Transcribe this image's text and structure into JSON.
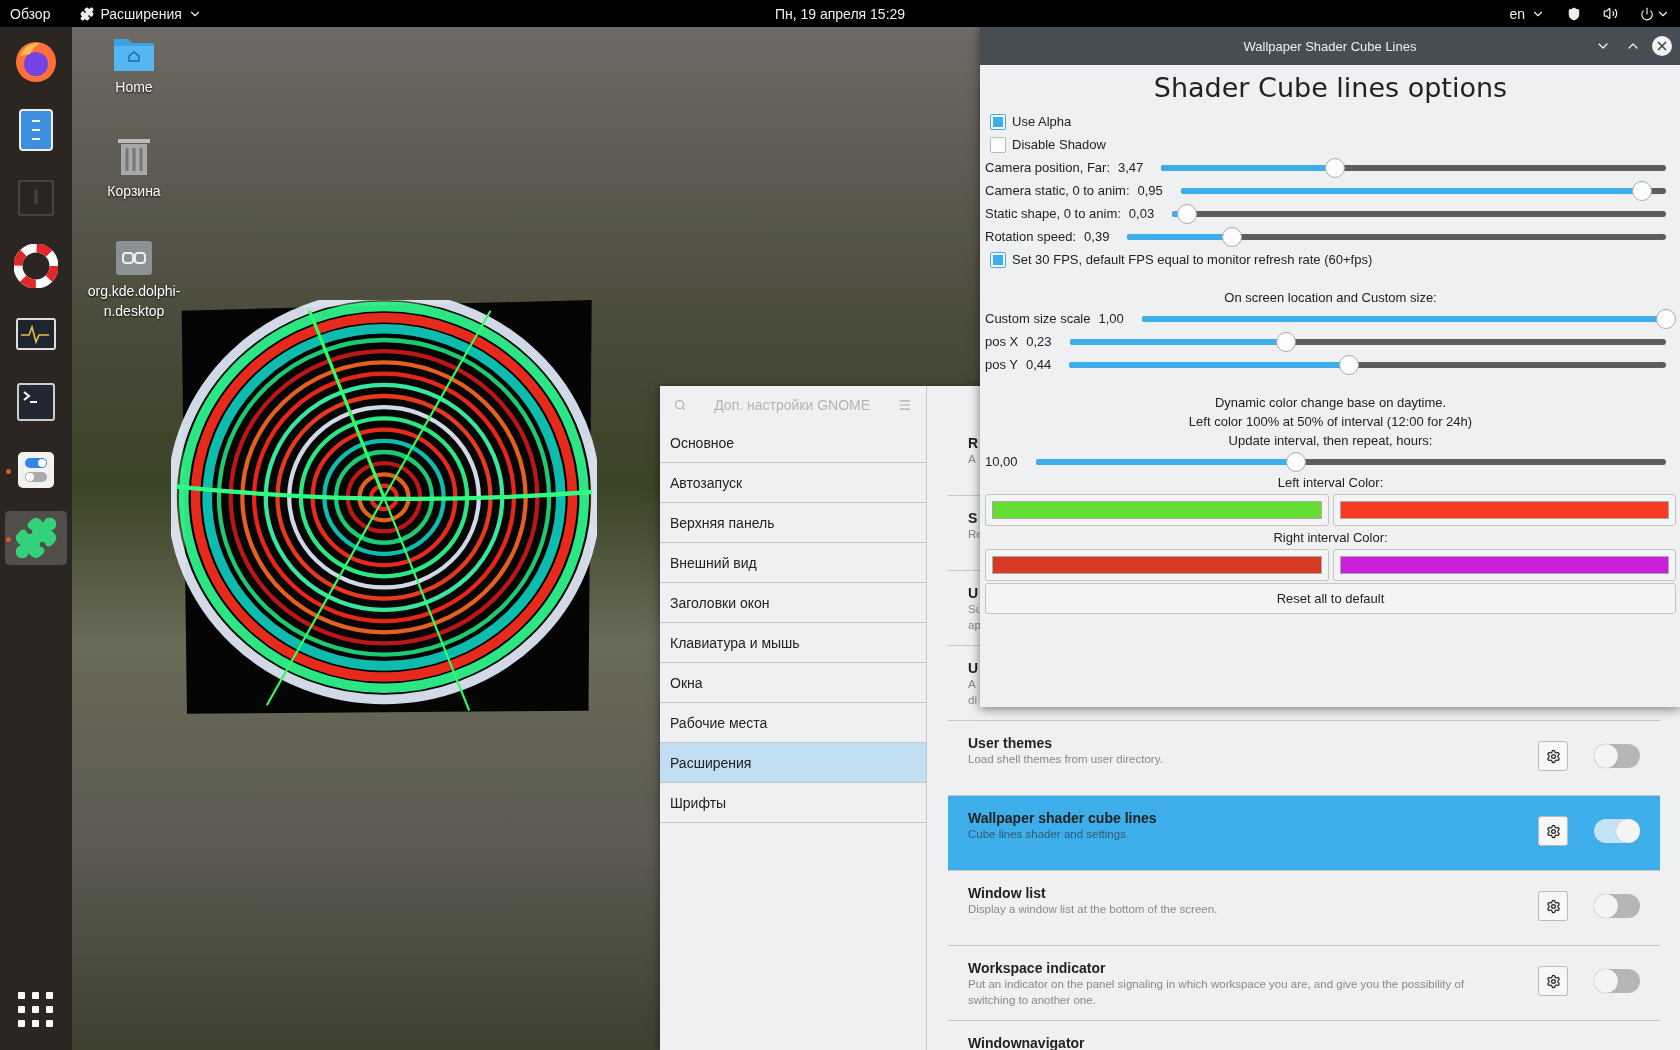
{
  "top_bar": {
    "activities": "Обзор",
    "app_menu": "Расширения",
    "clock": "Пн, 19 апреля  15:29",
    "keyboard_layout": "en"
  },
  "dock": {
    "items": [
      {
        "kind": "browser",
        "running": false,
        "selected": false
      },
      {
        "kind": "files",
        "running": false,
        "selected": false
      },
      {
        "kind": "dimmed",
        "running": false,
        "selected": false
      },
      {
        "kind": "help",
        "running": false,
        "selected": false
      },
      {
        "kind": "monitor",
        "running": false,
        "selected": false
      },
      {
        "kind": "terminal",
        "running": false,
        "selected": false
      },
      {
        "kind": "tweaks",
        "running": true,
        "selected": false
      },
      {
        "kind": "extensions",
        "running": true,
        "selected": true
      }
    ]
  },
  "desktop_icons": [
    {
      "kind": "folder",
      "label": "Home"
    },
    {
      "kind": "trash",
      "label": "Корзина"
    },
    {
      "kind": "link",
      "label": "org.kde.dolphi-n.desktop"
    }
  ],
  "tweaks": {
    "title": "Доп. настройки GNOME",
    "sidebar": [
      {
        "label": "Основное",
        "selected": false
      },
      {
        "label": "Автозапуск",
        "selected": false
      },
      {
        "label": "Верхняя панель",
        "selected": false
      },
      {
        "label": "Внешний вид",
        "selected": false
      },
      {
        "label": "Заголовки окон",
        "selected": false
      },
      {
        "label": "Клавиатура и мышь",
        "selected": false
      },
      {
        "label": "Окна",
        "selected": false
      },
      {
        "label": "Рабочие места",
        "selected": false
      },
      {
        "label": "Расширения",
        "selected": true
      },
      {
        "label": "Шрифты",
        "selected": false
      }
    ],
    "extensions": [
      {
        "kind": "covered",
        "title": "R",
        "description": [
          "A"
        ]
      },
      {
        "kind": "covered",
        "title": "S",
        "description": [
          "Re"
        ]
      },
      {
        "kind": "covered",
        "title": "U",
        "description": [
          "Su",
          "ap"
        ]
      },
      {
        "kind": "covered",
        "title": "U",
        "description": [
          "A",
          "di"
        ]
      },
      {
        "kind": "full",
        "title": "User themes",
        "description": [
          "Load shell themes from user directory."
        ],
        "on": false,
        "selected": false
      },
      {
        "kind": "full",
        "title": "Wallpaper shader cube lines",
        "description": [
          "Cube lines shader and settings"
        ],
        "on": true,
        "selected": true
      },
      {
        "kind": "full",
        "title": "Window list",
        "description": [
          "Display a window list at the bottom of the screen."
        ],
        "on": false,
        "selected": false
      },
      {
        "kind": "full",
        "title": "Workspace indicator",
        "description": [
          "Put an indicator on the panel signaling in which workspace you are, and give you the possibility of",
          "switching to another one."
        ],
        "on": false,
        "selected": false
      },
      {
        "kind": "title_only",
        "title": "Windownavigator"
      }
    ]
  },
  "shader_window": {
    "title": "Wallpaper Shader Cube Lines",
    "heading": "Shader Cube lines options",
    "sections": [
      [
        {
          "kind": "checkbox",
          "label": "Use Alpha",
          "checked": true
        },
        {
          "kind": "checkbox",
          "label": "Disable Shadow",
          "checked": false
        },
        {
          "kind": "slider",
          "label": "Camera position, Far:",
          "value": "3,47",
          "level": 0.345
        },
        {
          "kind": "slider",
          "label": "Camera static, 0 to anim:",
          "value": "0,95",
          "level": 0.95
        },
        {
          "kind": "slider",
          "label": "Static shape, 0 to anim:",
          "value": "0,03",
          "level": 0.03
        },
        {
          "kind": "slider",
          "label": "Rotation speed:",
          "value": "0,39",
          "level": 0.195
        },
        {
          "kind": "checkbox",
          "label": "Set 30 FPS, default FPS equal to monitor refresh rate (60+fps)",
          "checked": true
        }
      ],
      [
        {
          "kind": "caption",
          "text": "On screen location and Custom size:"
        },
        {
          "kind": "slider",
          "label": "Custom size scale",
          "value": "1,00",
          "level": 1.0
        },
        {
          "kind": "slider",
          "label": "pos X",
          "value": "0,23",
          "level": 0.363
        },
        {
          "kind": "slider",
          "label": "pos Y",
          "value": "0,44",
          "level": 0.468
        }
      ],
      [
        {
          "kind": "caption",
          "text": "Dynamic color change base on daytime."
        },
        {
          "kind": "caption",
          "text": "Left color 100% at 50% of interval (12:00 for 24h)"
        },
        {
          "kind": "caption",
          "text": "Update interval, then repeat, hours:"
        },
        {
          "kind": "slider",
          "value": "10,00",
          "level": 0.413
        },
        {
          "kind": "caption",
          "text": "Left interval Color:"
        },
        {
          "kind": "colors",
          "colors": [
            {
              "color": "#66dd33"
            },
            {
              "color": "#f73a22"
            }
          ]
        },
        {
          "kind": "caption",
          "text": "Right interval Color:"
        },
        {
          "kind": "colors",
          "colors": [
            {
              "color": "#d63a22"
            },
            {
              "color": "#cc1edd"
            }
          ]
        },
        {
          "kind": "button",
          "label": "Reset all to default"
        }
      ]
    ]
  }
}
